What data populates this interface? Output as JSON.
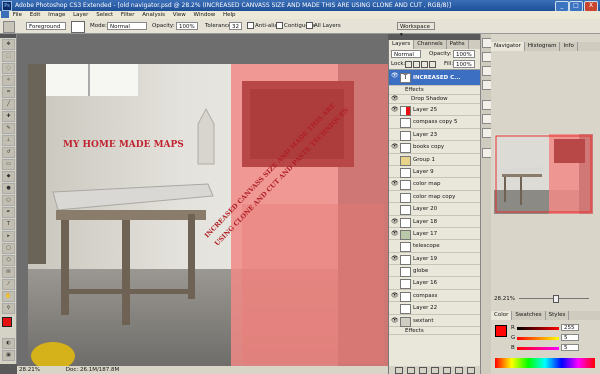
{
  "window": {
    "title": "Adobe Photoshop CS3 Extended - [old navigator.psd @ 28.2% (INCREASED CANVASS SIZE AND MADE THIS ARE  USING CLONE AND CUT , RGB/8)]",
    "min": "_",
    "max": "□",
    "close": "X"
  },
  "menu": [
    "File",
    "Edit",
    "Image",
    "Layer",
    "Select",
    "Filter",
    "Analysis",
    "View",
    "Window",
    "Help"
  ],
  "options": {
    "preset": "Foreground",
    "mode_label": "Mode:",
    "mode_value": "Normal",
    "opacity_label": "Opacity:",
    "opacity_value": "100%",
    "tolerance_label": "Tolerance:",
    "tolerance_value": "32",
    "antialias": "Anti-alias",
    "contiguous": "Contiguous",
    "all_layers": "All Layers",
    "workspace": "Workspace ▾"
  },
  "canvas": {
    "label1": "MY HOME MADE MAPS",
    "label2": "INCREASED CANVASS SIZE AND MADE THIS ARE",
    "label3": "USING CLONE AND CUT AND PASTE TECHNIQUES"
  },
  "status": {
    "zoom": "28.21%",
    "doc": "Doc: 26.1M/187.8M"
  },
  "layers_panel": {
    "tabs": [
      "Layers",
      "Channels",
      "Paths"
    ],
    "mode": "Normal",
    "opacity_label": "Opacity:",
    "opacity": "100%",
    "lock_label": "Lock:",
    "fill_label": "Fill:",
    "fill": "100%",
    "top_layer": "INCREASED C...",
    "effects": "Effects",
    "drop_shadow": "Drop Shadow",
    "layers": [
      "Layer 25",
      "compass copy 5",
      "Layer 23",
      "books copy",
      "Group 1",
      "Layer 9",
      "color map",
      "color map copy",
      "Layer 20",
      "Layer 18",
      "Layer 17",
      "telescope",
      "Layer 19",
      "globe",
      "Layer 16",
      "compass",
      "Layer 22",
      "sextant"
    ],
    "bottom_effects": "Effects"
  },
  "navigator": {
    "tabs": [
      "Navigator",
      "Histogram",
      "Info"
    ],
    "zoom": "28.21%"
  },
  "color_panel": {
    "tabs": [
      "Color",
      "Swatches",
      "Styles"
    ],
    "r_label": "R",
    "g_label": "G",
    "b_label": "B",
    "r": "255",
    "g": "5",
    "b": "5"
  },
  "colors": {
    "accent": "#e8504f",
    "foreground": "#ff0505"
  }
}
